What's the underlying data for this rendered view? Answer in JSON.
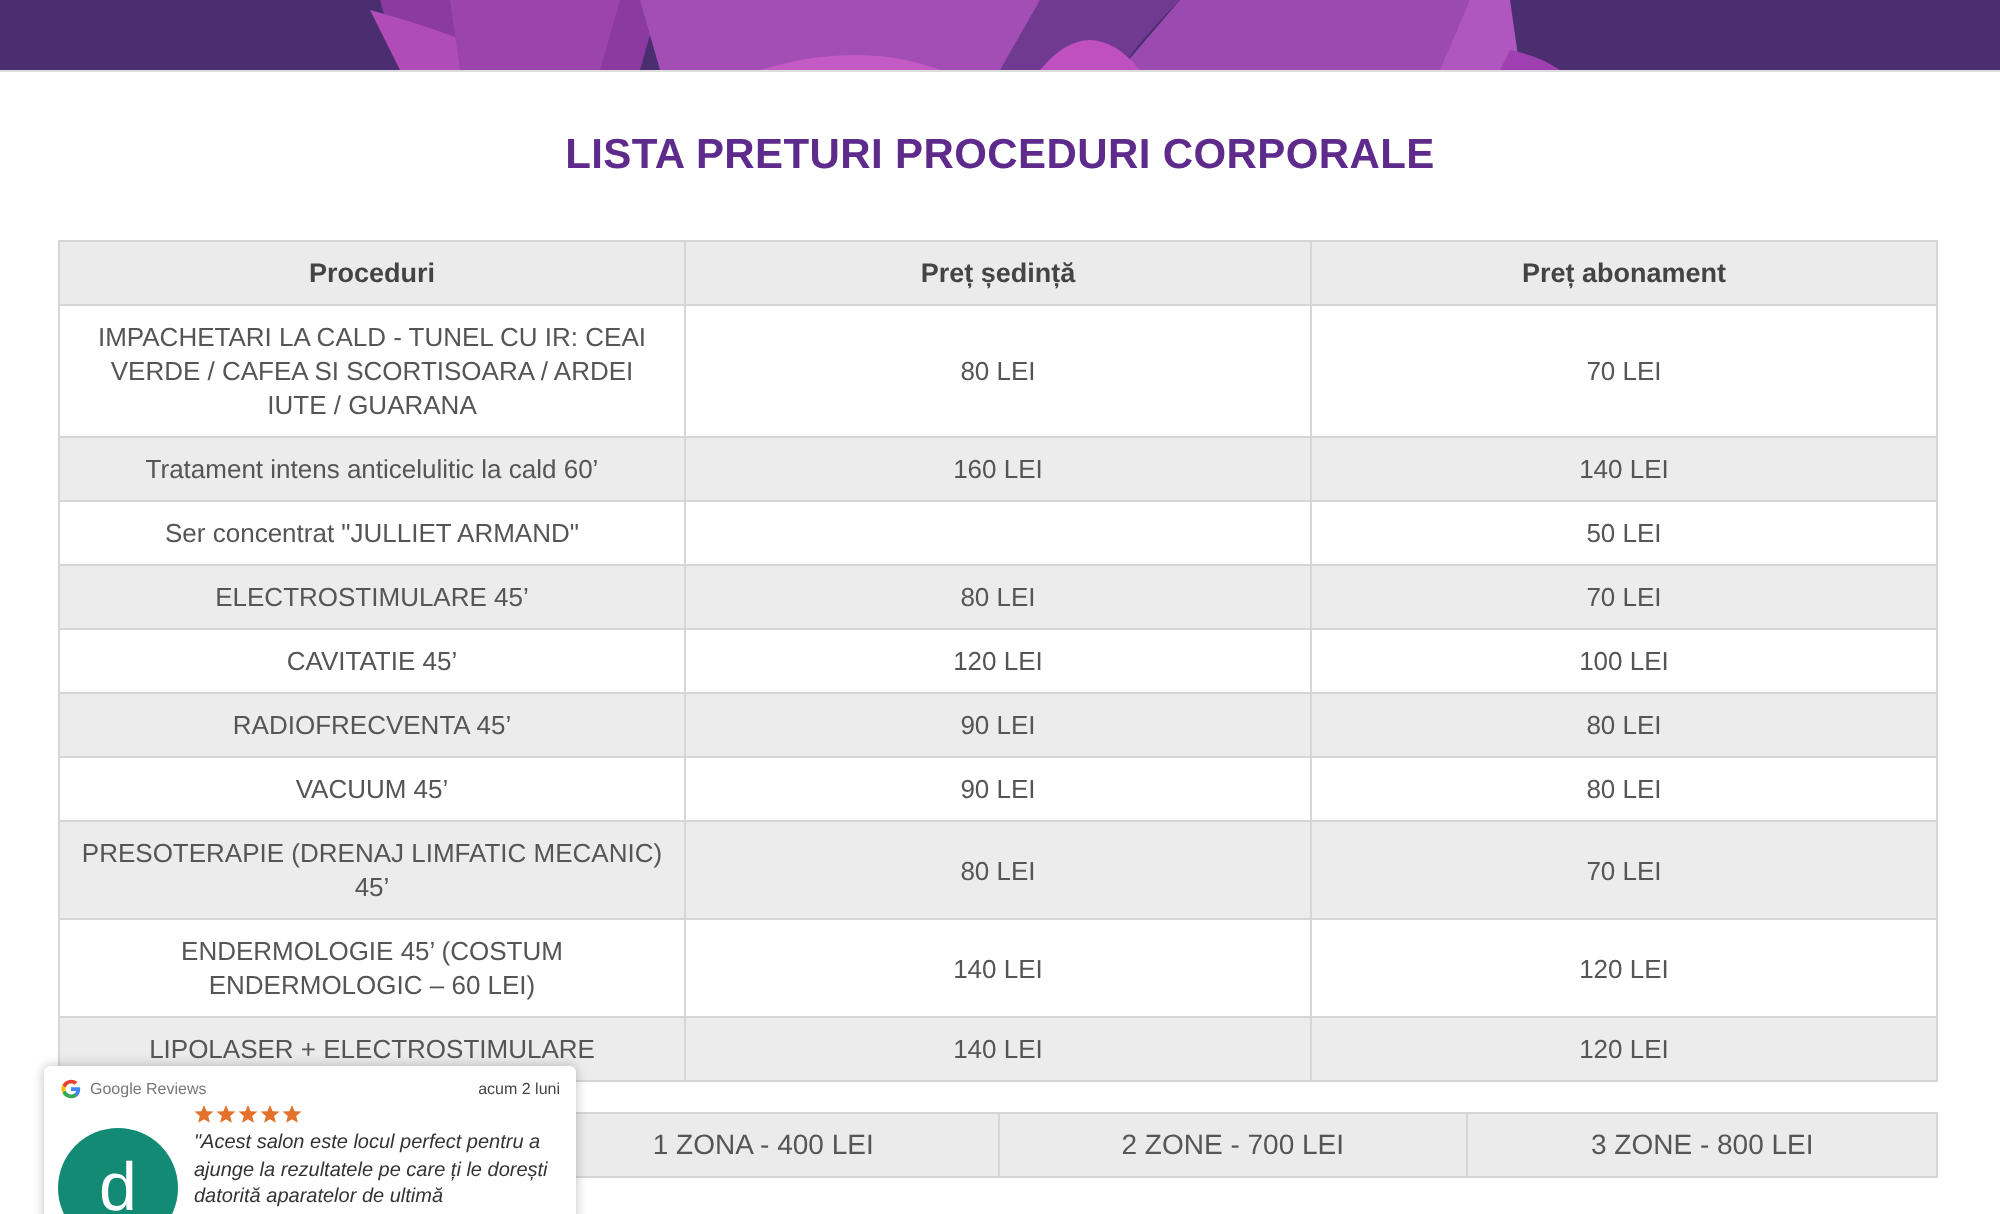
{
  "title": "LISTA PRETURI PROCEDURI CORPORALE",
  "table": {
    "columns": [
      "Proceduri",
      "Preț ședință",
      "Preț abonament"
    ],
    "rows": [
      [
        "IMPACHETARI LA CALD - TUNEL CU IR: CEAI VERDE / CAFEA SI SCORTISOARA / ARDEI IUTE / GUARANA",
        "80 LEI",
        "70 LEI"
      ],
      [
        "Tratament intens anticelulitic la cald 60’",
        "160 LEI",
        "140 LEI"
      ],
      [
        "Ser concentrat \"JULLIET ARMAND\"",
        "",
        "50 LEI"
      ],
      [
        "ELECTROSTIMULARE 45’",
        "80 LEI",
        "70 LEI"
      ],
      [
        "CAVITATIE 45’",
        "120 LEI",
        "100 LEI"
      ],
      [
        "RADIOFRECVENTA 45’",
        "90 LEI",
        "80 LEI"
      ],
      [
        "VACUUM 45’",
        "90 LEI",
        "80 LEI"
      ],
      [
        "PRESOTERAPIE (DRENAJ LIMFATIC MECANIC) 45’",
        "80 LEI",
        "70 LEI"
      ],
      [
        "ENDERMOLOGIE 45’ (COSTUM ENDERMOLOGIC – 60 LEI)",
        "140 LEI",
        "120 LEI"
      ],
      [
        "LIPOLASER + ELECTROSTIMULARE",
        "140 LEI",
        "120 LEI"
      ]
    ]
  },
  "zones": [
    "1 ZONA - 400 LEI",
    "2 ZONE - 700 LEI",
    "3 ZONE - 800 LEI"
  ],
  "review": {
    "source": "Google Reviews",
    "time": "acum 2 luni",
    "stars": 5,
    "avatar_letter": "d",
    "text": "\"Acest salon este locul perfect pentru a ajunge la rezultatele pe care ți le dorești datorită aparatelor de ultimă"
  }
}
